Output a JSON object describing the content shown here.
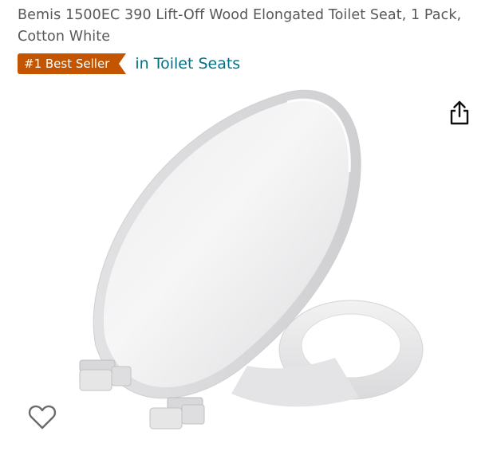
{
  "product": {
    "title": "Bemis 1500EC 390 Lift-Off Wood Elongated Toilet Seat, 1 Pack, Cotton White",
    "image_name": "toilet-seat-product-image"
  },
  "badge": {
    "label": "#1 Best Seller",
    "category_link": "in Toilet Seats",
    "badge_color": "#c45500",
    "link_color": "#007185"
  },
  "icons": {
    "share": "share-icon",
    "wishlist": "heart-outline-icon"
  }
}
